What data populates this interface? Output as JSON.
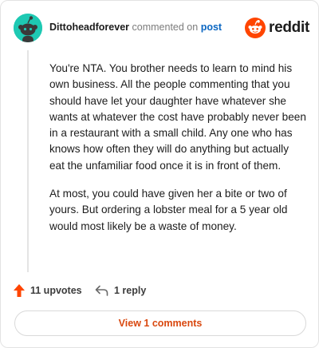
{
  "comment": {
    "username": "Dittoheadforever",
    "action_text": "commented on",
    "link_text": "post",
    "avatar_icon": "reddit-snoo-avatar-icon",
    "brand_icon": "reddit-logo-icon",
    "brand_name": "reddit",
    "paragraphs": [
      "You're NTA. You brother needs to learn to mind his own business. All the people commenting that you should have let your daughter have whatever she wants at whatever the cost have probably never been in a restaurant with a small child. Any one who has knows how often they will do anything but actually eat the unfamiliar food once it is in front of them.",
      "At most, you could have given her a bite or two of yours. But ordering a lobster meal for a 5 year old would most likely be a waste of money."
    ]
  },
  "actions": {
    "upvotes_label": "11 upvotes",
    "upvote_icon": "upvote-arrow-icon",
    "reply_label": "1 reply",
    "reply_icon": "reply-arrow-icon"
  },
  "footer": {
    "view_comments_label": "View 1 comments"
  },
  "colors": {
    "avatar_bg": "#1ec9b3",
    "reddit_orange": "#ff4500",
    "link_blue": "#0a66c2",
    "button_text": "#d9480f"
  }
}
